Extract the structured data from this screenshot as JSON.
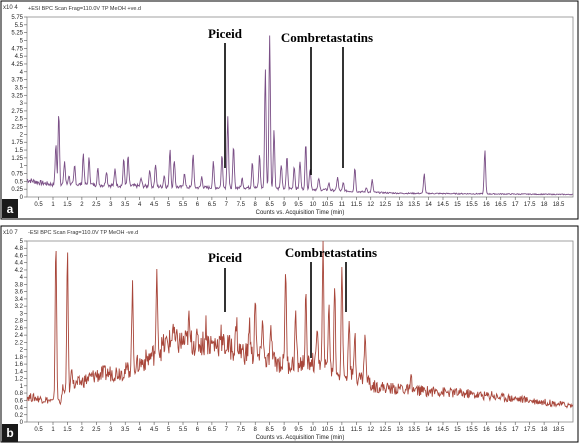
{
  "chart_data": [
    {
      "type": "line",
      "panel_label": "a",
      "header": "+ESI BPC Scan Frag=110.0V TP MeOH +ve.d",
      "multiplier": "x10 4",
      "xlabel": "Counts vs. Acquisition Time (min)",
      "xlim": [
        0.1,
        19.0
      ],
      "ylim": [
        0,
        5.75
      ],
      "x_ticks": [
        "0.5",
        "1",
        "1.5",
        "2",
        "2.5",
        "3",
        "3.5",
        "4",
        "4.5",
        "5",
        "5.5",
        "6",
        "6.5",
        "7",
        "7.5",
        "8",
        "8.5",
        "9",
        "9.5",
        "10",
        "10.5",
        "11",
        "11.5",
        "12",
        "12.5",
        "13",
        "13.5",
        "14",
        "14.5",
        "15",
        "15.5",
        "16",
        "16.5",
        "17",
        "17.5",
        "18",
        "18.5"
      ],
      "y_ticks": [
        "0",
        "0.25",
        "0.5",
        "0.75",
        "1",
        "1.25",
        "1.5",
        "1.75",
        "2",
        "2.25",
        "2.5",
        "2.75",
        "3",
        "3.25",
        "3.5",
        "3.75",
        "4",
        "4.25",
        "4.5",
        "4.75",
        "5",
        "5.25",
        "5.5",
        "5.75"
      ],
      "line_color": "#7a4f86",
      "baseline": [
        [
          0.1,
          0.55
        ],
        [
          0.6,
          0.45
        ],
        [
          1.0,
          0.4
        ],
        [
          2.0,
          0.4
        ],
        [
          4.0,
          0.35
        ],
        [
          6.0,
          0.3
        ],
        [
          8.0,
          0.3
        ],
        [
          10.0,
          0.25
        ],
        [
          12.0,
          0.15
        ],
        [
          13.0,
          0.12
        ],
        [
          19.0,
          0.08
        ]
      ],
      "peaks": [
        [
          0.75,
          0.35
        ],
        [
          1.1,
          1.7
        ],
        [
          1.2,
          2.75
        ],
        [
          1.4,
          1.15
        ],
        [
          1.55,
          0.7
        ],
        [
          1.75,
          1.0
        ],
        [
          2.05,
          1.4
        ],
        [
          2.25,
          1.25
        ],
        [
          2.55,
          0.9
        ],
        [
          2.85,
          0.85
        ],
        [
          3.15,
          0.9
        ],
        [
          3.45,
          1.2
        ],
        [
          3.6,
          1.3
        ],
        [
          4.05,
          0.6
        ],
        [
          4.35,
          0.9
        ],
        [
          4.55,
          1.05
        ],
        [
          4.85,
          0.7
        ],
        [
          5.05,
          1.55
        ],
        [
          5.2,
          1.2
        ],
        [
          5.55,
          0.8
        ],
        [
          5.85,
          1.4
        ],
        [
          6.15,
          0.65
        ],
        [
          6.55,
          1.1
        ],
        [
          6.85,
          1.35
        ],
        [
          7.05,
          2.6
        ],
        [
          7.25,
          1.6
        ],
        [
          7.55,
          0.6
        ],
        [
          7.9,
          1.15
        ],
        [
          8.15,
          1.35
        ],
        [
          8.35,
          4.1
        ],
        [
          8.5,
          5.2
        ],
        [
          8.65,
          2.15
        ],
        [
          8.9,
          1.05
        ],
        [
          9.1,
          1.3
        ],
        [
          9.35,
          1.0
        ],
        [
          9.55,
          1.15
        ],
        [
          9.75,
          1.7
        ],
        [
          9.9,
          0.95
        ],
        [
          10.2,
          0.6
        ],
        [
          10.55,
          0.45
        ],
        [
          10.85,
          0.65
        ],
        [
          11.05,
          0.45
        ],
        [
          11.45,
          0.95
        ],
        [
          11.85,
          0.3
        ],
        [
          12.05,
          0.55
        ],
        [
          13.85,
          0.75
        ],
        [
          15.95,
          1.5
        ]
      ]
    },
    {
      "type": "line",
      "panel_label": "b",
      "header": "-ESI BPC Scan Frag=110.0V TP MeOH -ve.d",
      "multiplier": "x10 7",
      "xlabel": "Counts vs. Acquisition Time (min)",
      "xlim": [
        0.1,
        19.0
      ],
      "ylim": [
        0,
        5.0
      ],
      "x_ticks": [
        "0.5",
        "1",
        "1.5",
        "2",
        "2.5",
        "3",
        "3.5",
        "4",
        "4.5",
        "5",
        "5.5",
        "6",
        "6.5",
        "7",
        "7.5",
        "8",
        "8.5",
        "9",
        "9.5",
        "10",
        "10.5",
        "11",
        "11.5",
        "12",
        "12.5",
        "13",
        "13.5",
        "14",
        "14.5",
        "15",
        "15.5",
        "16",
        "16.5",
        "17",
        "17.5",
        "18",
        "18.5"
      ],
      "y_ticks": [
        "0",
        "0.2",
        "0.4",
        "0.6",
        "0.8",
        "1",
        "1.2",
        "1.4",
        "1.6",
        "1.8",
        "2",
        "2.2",
        "2.4",
        "2.6",
        "2.8",
        "3",
        "3.2",
        "3.4",
        "3.6",
        "3.8",
        "4",
        "4.2",
        "4.4",
        "4.6",
        "4.8",
        "5"
      ],
      "line_color": "#a8463a",
      "baseline": [
        [
          0.1,
          0.7
        ],
        [
          0.85,
          0.6
        ],
        [
          1.0,
          0.55
        ],
        [
          1.3,
          0.6
        ],
        [
          1.7,
          1.0
        ],
        [
          2.5,
          1.3
        ],
        [
          3.5,
          1.4
        ],
        [
          4.2,
          1.7
        ],
        [
          5.0,
          2.2
        ],
        [
          6.0,
          2.2
        ],
        [
          7.0,
          2.1
        ],
        [
          8.0,
          1.8
        ],
        [
          9.0,
          1.6
        ],
        [
          10.0,
          1.6
        ],
        [
          11.0,
          1.3
        ],
        [
          11.9,
          1.2
        ],
        [
          12.0,
          1.0
        ],
        [
          13.0,
          0.9
        ],
        [
          15.0,
          0.8
        ],
        [
          17.0,
          0.65
        ],
        [
          19.0,
          0.45
        ]
      ],
      "peaks": [
        [
          1.1,
          5.0
        ],
        [
          1.35,
          1.0
        ],
        [
          1.5,
          4.7
        ],
        [
          1.65,
          1.6
        ],
        [
          2.35,
          1.0
        ],
        [
          2.85,
          1.0
        ],
        [
          3.45,
          1.2
        ],
        [
          3.75,
          3.7
        ],
        [
          4.6,
          4.1
        ],
        [
          5.15,
          2.7
        ],
        [
          5.7,
          2.8
        ],
        [
          6.3,
          2.7
        ],
        [
          6.8,
          2.6
        ],
        [
          7.35,
          2.8
        ],
        [
          7.8,
          2.8
        ],
        [
          8.0,
          3.5
        ],
        [
          8.25,
          3.0
        ],
        [
          8.55,
          2.6
        ],
        [
          9.05,
          4.3
        ],
        [
          9.4,
          3.0
        ],
        [
          9.75,
          3.4
        ],
        [
          9.95,
          1.8
        ],
        [
          10.15,
          2.8
        ],
        [
          10.35,
          4.8
        ],
        [
          10.55,
          3.4
        ],
        [
          10.75,
          3.8
        ],
        [
          11.0,
          4.4
        ],
        [
          11.25,
          3.0
        ],
        [
          11.45,
          2.5
        ],
        [
          11.8,
          2.5
        ],
        [
          13.05,
          1.0
        ],
        [
          13.4,
          1.2
        ],
        [
          14.3,
          0.9
        ],
        [
          15.4,
          0.8
        ],
        [
          16.2,
          0.8
        ]
      ]
    }
  ],
  "annotations": {
    "panel_a": {
      "piceid": "Piceid",
      "combretastatins": "Combretastatins"
    },
    "panel_b": {
      "piceid": "Piceid",
      "combretastatins": "Combretastatins"
    }
  }
}
